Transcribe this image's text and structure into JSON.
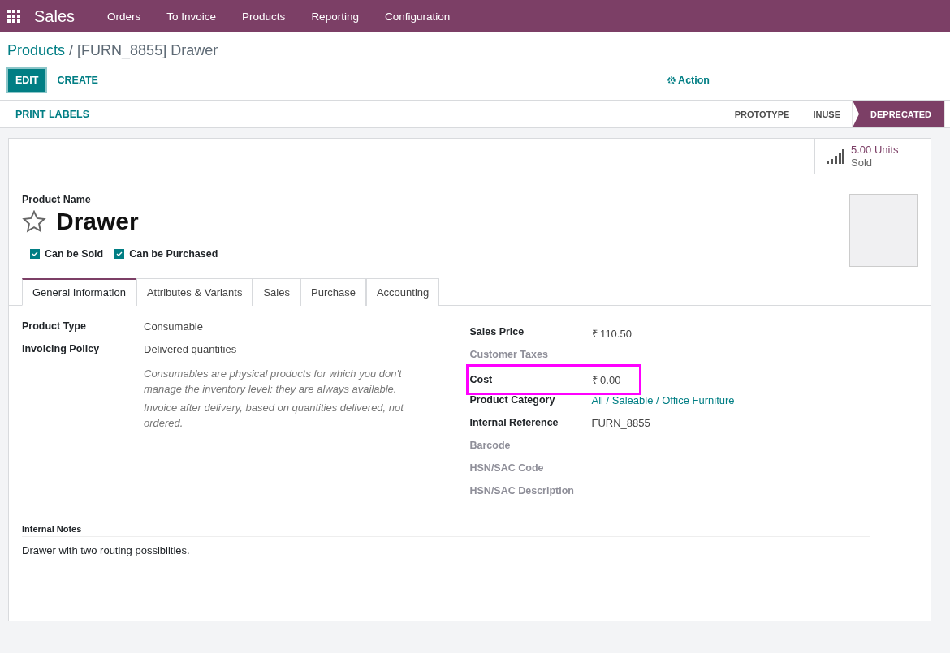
{
  "navbar": {
    "app": "Sales",
    "menu": [
      "Orders",
      "To Invoice",
      "Products",
      "Reporting",
      "Configuration"
    ]
  },
  "breadcrumb": {
    "parent": "Products",
    "separator": "/",
    "current": "[FURN_8855] Drawer"
  },
  "buttons": [
    {
      "label": "EDIT",
      "kind": "primary"
    },
    {
      "label": "CREATE",
      "kind": "link"
    }
  ],
  "action": "Action",
  "statusbar": {
    "buttons": [
      "PRINT LABELS"
    ],
    "stages": [
      {
        "label": "PROTOTYPE",
        "selected": false,
        "highlighted": false
      },
      {
        "label": "INUSE",
        "selected": false,
        "highlighted": false
      },
      {
        "label": "DEPRECATED",
        "selected": true,
        "highlighted": true
      }
    ]
  },
  "stat_button": {
    "value": "5.00 Units",
    "label": "Sold"
  },
  "product": {
    "name_label": "Product Name",
    "name": "Drawer",
    "favorite": false,
    "options": [
      {
        "label": "Can be Sold",
        "checked": true
      },
      {
        "label": "Can be Purchased",
        "checked": true
      }
    ]
  },
  "tabs": [
    {
      "label": "General Information",
      "selected": true
    },
    {
      "label": "Attributes & Variants",
      "selected": false
    },
    {
      "label": "Sales",
      "selected": false
    },
    {
      "label": "Purchase",
      "selected": false
    },
    {
      "label": "Accounting",
      "selected": false
    }
  ],
  "left_fields": [
    {
      "label": "Product Type",
      "value": "Consumable"
    },
    {
      "label": "Invoicing Policy",
      "value": "Delivered quantities"
    }
  ],
  "help_texts": [
    "Consumables are physical products for which you don't manage the inventory level: they are always available.",
    "Invoice after delivery, based on quantities delivered, not ordered."
  ],
  "right_fields": [
    {
      "label": "Sales Price",
      "value": "₹ 110.50",
      "kind": "text",
      "highlighted": false
    },
    {
      "label": "Customer Taxes",
      "highlighted": false
    },
    {
      "label": "Cost",
      "value": "₹ 0.00",
      "kind": "text",
      "highlighted": true
    },
    {
      "label": "Product Category",
      "value": "All / Saleable / Office Furniture",
      "kind": "link",
      "highlighted": false
    },
    {
      "label": "Internal Reference",
      "value": "FURN_8855",
      "kind": "text",
      "highlighted": false
    },
    {
      "label": "Barcode",
      "highlighted": false
    },
    {
      "label": "HSN/SAC Code",
      "highlighted": false
    },
    {
      "label": "HSN/SAC Description",
      "highlighted": false
    }
  ],
  "notes": {
    "label": "Internal Notes",
    "text": "Drawer with two routing possiblities."
  }
}
